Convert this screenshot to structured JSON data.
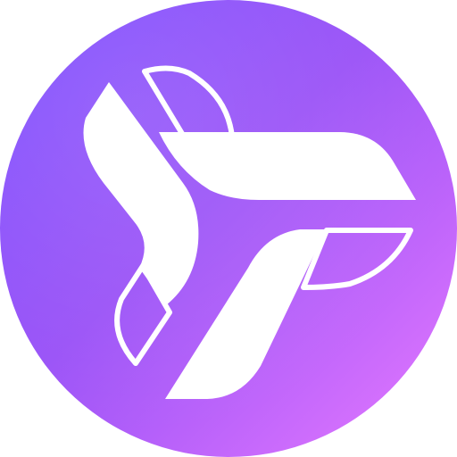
{
  "logo": {
    "icon": "tri-blade-pinwheel-icon",
    "colors": {
      "gradient_start": "#7b4dff",
      "gradient_mid": "#9a52f7",
      "gradient_end": "#e77aff",
      "mark": "#ffffff"
    }
  }
}
